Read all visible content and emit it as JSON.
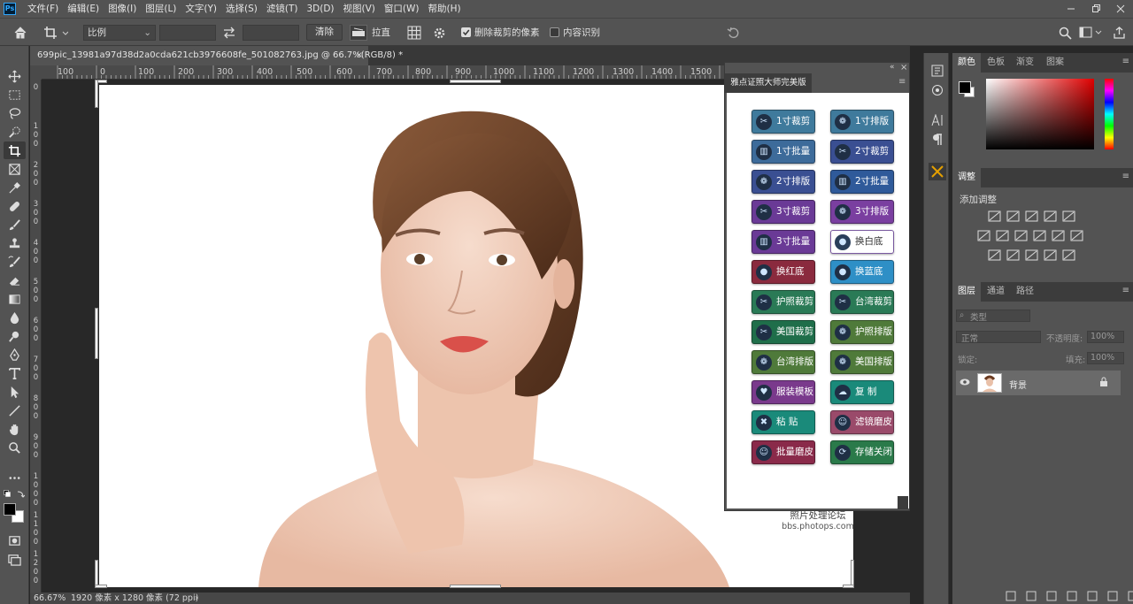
{
  "app": {
    "logo": "Ps"
  },
  "menubar": {
    "items": [
      "文件(F)",
      "编辑(E)",
      "图像(I)",
      "图层(L)",
      "文字(Y)",
      "选择(S)",
      "滤镜(T)",
      "3D(D)",
      "视图(V)",
      "窗口(W)",
      "帮助(H)"
    ]
  },
  "options": {
    "ratio_value": "比例",
    "ratio_width": "",
    "ratio_height": "",
    "clear_label": "清除",
    "straighten_label": "拉直",
    "delete_cropped_label": "删除裁剪的像素",
    "content_aware_label": "内容识别",
    "delete_cropped_checked": true,
    "content_aware_checked": false
  },
  "document": {
    "tab_title": "699pic_13981a97d38d2a0cda621cb3976608fe_501082763.jpg @ 66.7%(RGB/8) *",
    "tab_close": "×",
    "zoom": "66.67%",
    "size_info": "1920 像素 x 1280 像素 (72 ppi)",
    "status_arrow": "›"
  },
  "rulers": {
    "horizontal": [
      "100",
      "0",
      "100",
      "200",
      "300",
      "400",
      "500",
      "600",
      "700",
      "800",
      "900",
      "1000",
      "1100",
      "1200",
      "1300",
      "1400",
      "1500"
    ],
    "vertical": [
      "0",
      "1\n0\n0",
      "2\n0\n0",
      "3\n0\n0",
      "4\n0\n0",
      "5\n0\n0",
      "6\n0\n0",
      "7\n0\n0",
      "8\n0\n0",
      "9\n0\n0",
      "1\n0\n0\n0",
      "1\n1\n0\n0",
      "1\n2\n0\n0"
    ]
  },
  "plugin": {
    "title": "雅点证照大师完美版",
    "buttons": [
      {
        "label": "1寸裁剪",
        "color": "#3f7a9c",
        "icon": "scissors"
      },
      {
        "label": "1寸排版",
        "color": "#3f7a9c",
        "icon": "balls"
      },
      {
        "label": "1寸批量",
        "color": "#3d6b9a",
        "icon": "chart"
      },
      {
        "label": "2寸裁剪",
        "color": "#3a4f92",
        "icon": "scissors"
      },
      {
        "label": "2寸排版",
        "color": "#3a4f92",
        "icon": "balls"
      },
      {
        "label": "2寸批量",
        "color": "#2f5a9a",
        "icon": "chart"
      },
      {
        "label": "3寸裁剪",
        "color": "#6a3a96",
        "icon": "scissors"
      },
      {
        "label": "3寸排版",
        "color": "#7a3fa0",
        "icon": "balls"
      },
      {
        "label": "3寸批量",
        "color": "#6a3a96",
        "icon": "chart"
      },
      {
        "label": "换白底",
        "color": "#ffffff",
        "icon": "dot"
      },
      {
        "label": "换红底",
        "color": "#8a2a3e",
        "icon": "dot"
      },
      {
        "label": "换蓝底",
        "color": "#2e8fc6",
        "icon": "dot"
      },
      {
        "label": "护照裁剪",
        "color": "#2a7a56",
        "icon": "scissors"
      },
      {
        "label": "台湾裁剪",
        "color": "#2a7a56",
        "icon": "scissors"
      },
      {
        "label": "美国裁剪",
        "color": "#1f6e4a",
        "icon": "scissors"
      },
      {
        "label": "护照排版",
        "color": "#4f7a3a",
        "icon": "balls"
      },
      {
        "label": "台湾排版",
        "color": "#4f7a3a",
        "icon": "balls"
      },
      {
        "label": "美国排版",
        "color": "#4f7a3a",
        "icon": "balls"
      },
      {
        "label": "服装模板",
        "color": "#7a3a8c",
        "icon": "shirt"
      },
      {
        "label": "复  制",
        "color": "#1a8a7a",
        "icon": "cloud"
      },
      {
        "label": "粘  贴",
        "color": "#1a8a7a",
        "icon": "cross"
      },
      {
        "label": "滤镜磨皮",
        "color": "#9a4a6a",
        "icon": "person"
      },
      {
        "label": "批量磨皮",
        "color": "#8a2a4a",
        "icon": "person"
      },
      {
        "label": "存储关闭",
        "color": "#2a7a4a",
        "icon": "save"
      }
    ],
    "forum_name": "照片处理论坛",
    "forum_url": "bbs.photops.com"
  },
  "panels": {
    "color_tabs": [
      "颜色",
      "色板",
      "渐变",
      "图案"
    ],
    "adjust_title": "调整",
    "adjust_label": "添加调整",
    "layers_tabs": [
      "图层",
      "通道",
      "路径"
    ],
    "layer_filter": "类型",
    "blend_mode": "正常",
    "opacity_label": "不透明度:",
    "opacity_value": "100%",
    "lock_label": "锁定:",
    "fill_label": "填充:",
    "fill_value": "100%",
    "layer_name": "背景"
  },
  "colors": {
    "accent": "#31a8ff",
    "foreground": "#000000",
    "background": "#ffffff"
  }
}
